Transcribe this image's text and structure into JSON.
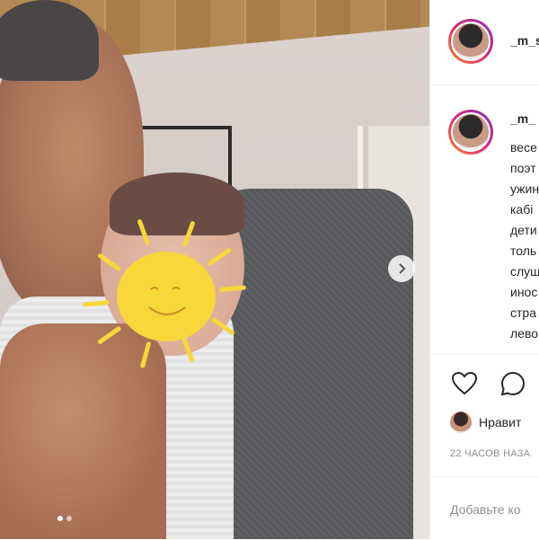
{
  "post": {
    "author": "_m_s",
    "caption_author": "_m_",
    "caption_lines": [
      "весе",
      "поэт",
      "ужин",
      "кабі",
      "дети",
      "толь",
      "слуш",
      "инос",
      "стра",
      "лево"
    ],
    "likes_label": "Нравит",
    "time_label": "22 ЧАСОВ НАЗА",
    "comment_placeholder": "Добавьте ко"
  },
  "icons": {
    "next": "chevron-right-icon",
    "like": "heart-icon",
    "comment": "comment-bubble-icon"
  },
  "carousel": {
    "slide_count": 2,
    "active_index": 0
  },
  "colors": {
    "sun": "#f7d73a",
    "text": "#262626",
    "muted": "#8e8e8e",
    "avatar_ring": "#dd2a7b"
  }
}
